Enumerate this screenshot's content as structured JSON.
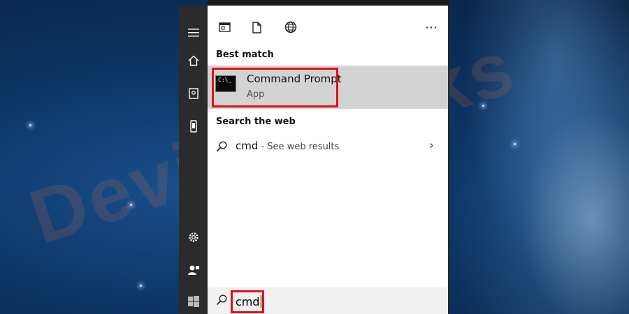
{
  "watermark": "DeviceTricks",
  "toolbar": {
    "icons": [
      "app-window-icon",
      "document-icon",
      "globe-icon",
      "more-icon"
    ],
    "more_glyph": "⋯"
  },
  "rail": {
    "icons": [
      "hamburger-menu-icon",
      "home-icon",
      "notebook-icon",
      "phone-icon",
      "settings-icon",
      "user-icon",
      "windows-start-icon"
    ]
  },
  "best_match": {
    "label": "Best match",
    "app_name": "Command Prompt",
    "app_type": "App",
    "icon_text": "C:\\_"
  },
  "web": {
    "label": "Search the web",
    "query": "cmd",
    "suffix": " - See web results",
    "chevron": "›"
  },
  "search": {
    "value": "cmd"
  },
  "colors": {
    "highlight": "#e0101a",
    "selected_row": "#d3d3d3",
    "rail": "#2b2b2b"
  }
}
